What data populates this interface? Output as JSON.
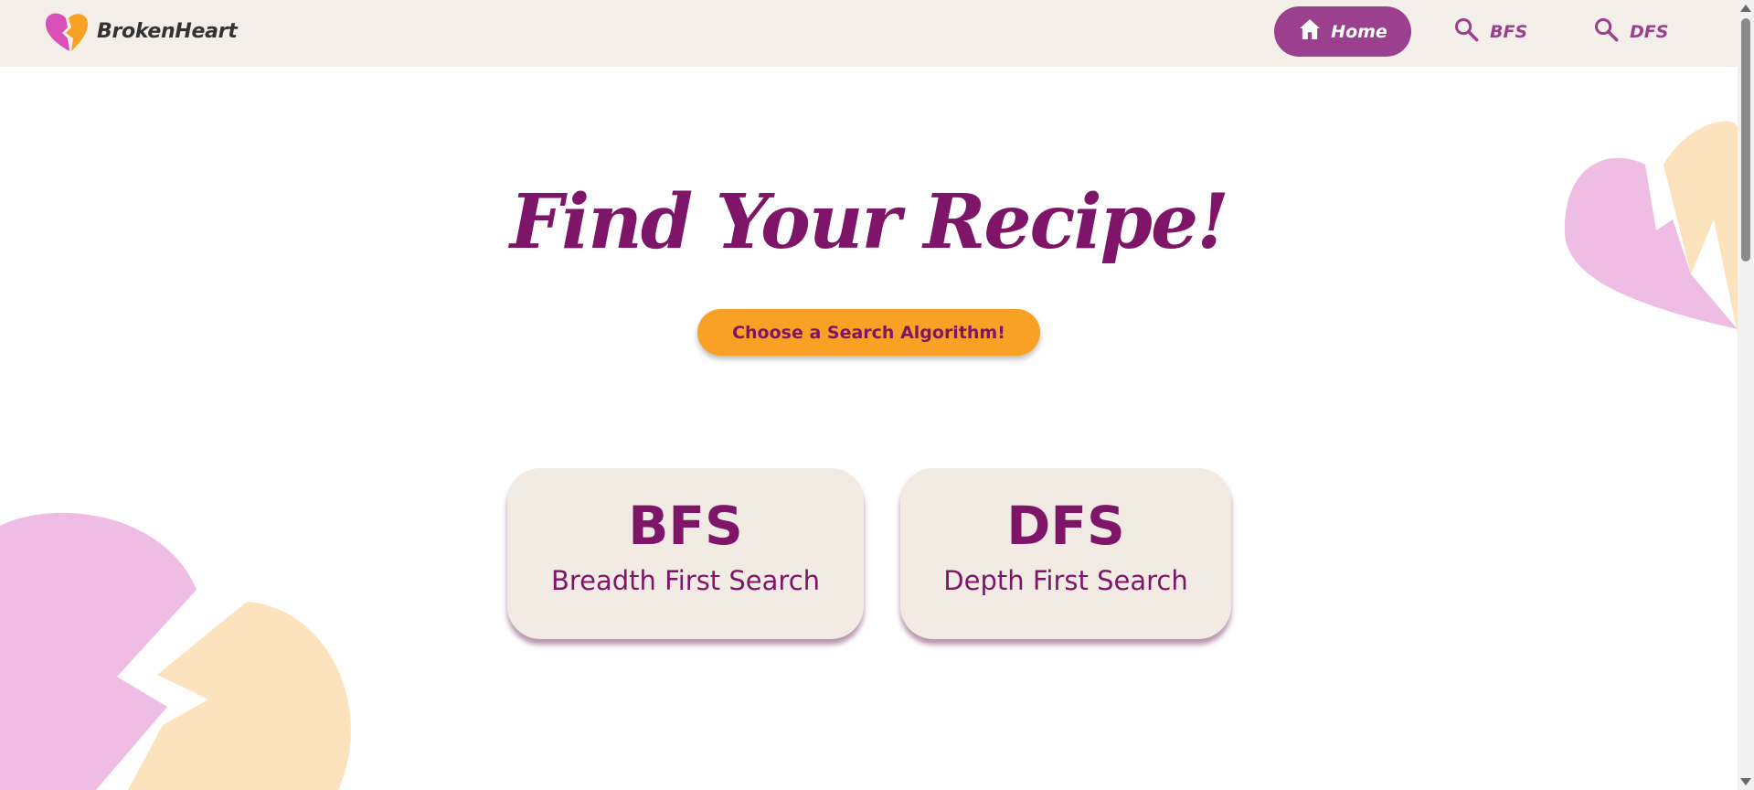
{
  "brand": {
    "name": "BrokenHeart",
    "logo_icon": "broken-heart-icon"
  },
  "nav": {
    "home": {
      "label": "Home",
      "icon": "home-icon"
    },
    "bfs": {
      "label": "BFS",
      "icon": "search-icon"
    },
    "dfs": {
      "label": "DFS",
      "icon": "search-icon"
    }
  },
  "hero": {
    "title": "Find Your Recipe!",
    "cta_label": "Choose a Search Algorithm!"
  },
  "cards": [
    {
      "title": "BFS",
      "subtitle": "Breadth First Search"
    },
    {
      "title": "DFS",
      "subtitle": "Depth First Search"
    }
  ],
  "colors": {
    "primary": "#7e1568",
    "nav_active": "#9b3f8f",
    "accent": "#f9a125",
    "navbar_bg": "#f4efe9",
    "card_bg": "#f1ebe4",
    "heart_pink": "#efbde3",
    "heart_peach": "#fde3bd"
  }
}
